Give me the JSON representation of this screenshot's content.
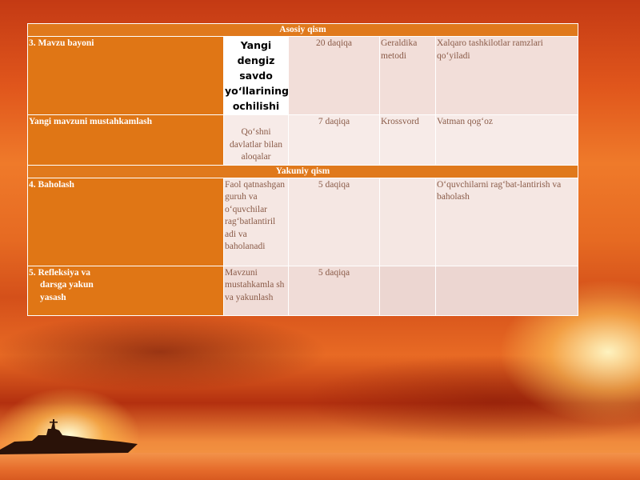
{
  "sections": {
    "main": "Asosiy qism",
    "final": "Yakuniy qism"
  },
  "rows": [
    {
      "stage": "3. Mavzu bayoni",
      "content": "Yangi dengiz savdo yo‘llarining ochilishi",
      "time": "20 daqiqa",
      "method": "Geraldika metodi",
      "activity": "Xalqaro tashkilotlar ramzlari qo‘yiladi"
    },
    {
      "stage": "Yangi mavzuni mustahkamlash",
      "content": "Qo‘shni davlatlar bilan aloqalar",
      "time": "7 daqiqa",
      "method": "Krossvord",
      "activity": "Vatman qog‘oz"
    },
    {
      "stage": "4. Baholash",
      "content": "Faol qatnashgan guruh va o‘quvchilar rag‘batlantiril adi va baholanadi",
      "time": "5 daqiqa",
      "method": "",
      "activity": "O‘quvchilarni rag‘bat-lantirish va baholash"
    },
    {
      "stage_line1": "5. Refleksiya va",
      "stage_line2": "darsga yakun",
      "stage_line3": "yasash",
      "content": "Mavzuni mustahkamla sh va yakunlash",
      "time": "5 daqiqa",
      "method": "",
      "activity": ""
    }
  ]
}
